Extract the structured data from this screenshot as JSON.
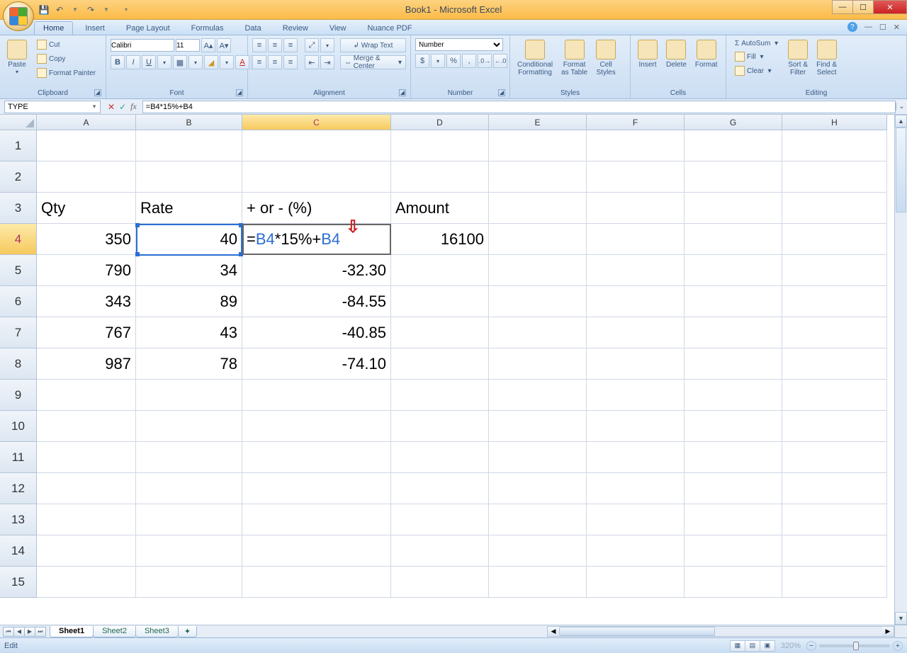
{
  "window": {
    "title": "Book1 - Microsoft Excel"
  },
  "qat": {
    "save": "save",
    "undo": "undo",
    "redo": "redo"
  },
  "tabs": [
    "Home",
    "Insert",
    "Page Layout",
    "Formulas",
    "Data",
    "Review",
    "View",
    "Nuance PDF"
  ],
  "active_tab": "Home",
  "ribbon": {
    "clipboard": {
      "label": "Clipboard",
      "paste": "Paste",
      "cut": "Cut",
      "copy": "Copy",
      "fp": "Format Painter"
    },
    "font": {
      "label": "Font",
      "name": "Calibri",
      "size": "11"
    },
    "alignment": {
      "label": "Alignment",
      "wrap": "Wrap Text",
      "merge": "Merge & Center"
    },
    "number": {
      "label": "Number",
      "format": "Number"
    },
    "styles": {
      "label": "Styles",
      "cf": "Conditional",
      "cf2": "Formatting",
      "fat": "Format",
      "fat2": "as Table",
      "cs": "Cell",
      "cs2": "Styles"
    },
    "cells": {
      "label": "Cells",
      "insert": "Insert",
      "delete": "Delete",
      "format": "Format"
    },
    "editing": {
      "label": "Editing",
      "autosum": "AutoSum",
      "fill": "Fill",
      "clear": "Clear",
      "sort": "Sort &",
      "sort2": "Filter",
      "find": "Find &",
      "find2": "Select"
    }
  },
  "namebox": "TYPE",
  "formula": "=B4*15%+B4",
  "formula_parts": {
    "p1": "=",
    "p2": "B4",
    "p3": "*15%+",
    "p4": "B4"
  },
  "columns": [
    "A",
    "B",
    "C",
    "D",
    "E",
    "F",
    "G",
    "H"
  ],
  "selected_col": "C",
  "selected_row": "4",
  "headers": {
    "A": "Qty",
    "B": "Rate",
    "C": "+ or - (%)",
    "D": "Amount"
  },
  "rows": [
    {
      "A": "350",
      "B": "40",
      "C": "=B4*15%+B4",
      "D": "16100"
    },
    {
      "A": "790",
      "B": "34",
      "C": "-32.30",
      "D": ""
    },
    {
      "A": "343",
      "B": "89",
      "C": "-84.55",
      "D": ""
    },
    {
      "A": "767",
      "B": "43",
      "C": "-40.85",
      "D": ""
    },
    {
      "A": "987",
      "B": "78",
      "C": "-74.10",
      "D": ""
    }
  ],
  "sheets": [
    "Sheet1",
    "Sheet2",
    "Sheet3"
  ],
  "active_sheet": "Sheet1",
  "status": {
    "mode": "Edit",
    "zoom": "320%"
  }
}
